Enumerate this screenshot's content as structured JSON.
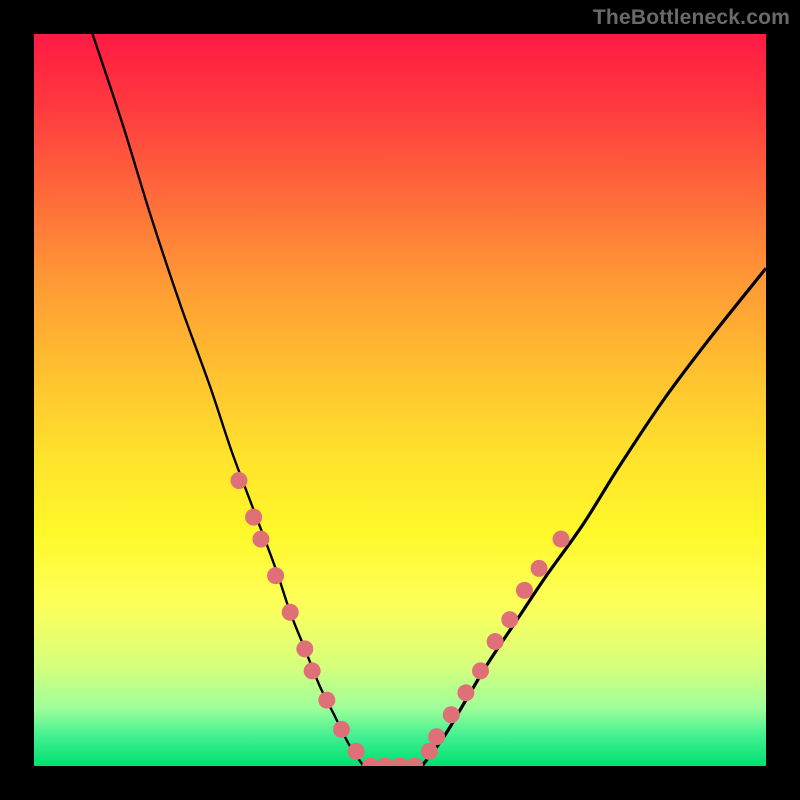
{
  "watermark": "TheBottleneck.com",
  "colors": {
    "background": "#000000",
    "gradient_top": "#ff1a44",
    "gradient_mid": "#ffe32c",
    "gradient_bottom": "#00e070",
    "curve": "#000000",
    "dot": "#e07078"
  },
  "chart_data": {
    "type": "line",
    "title": "",
    "xlabel": "",
    "ylabel": "",
    "xlim": [
      0,
      100
    ],
    "ylim": [
      0,
      100
    ],
    "series": [
      {
        "name": "left-curve",
        "x": [
          8,
          12,
          16,
          20,
          24,
          27,
          30,
          33,
          35,
          37,
          39,
          41,
          43,
          45
        ],
        "y": [
          100,
          88,
          75,
          63,
          52,
          43,
          35,
          27,
          21,
          16,
          11,
          7,
          3,
          0
        ]
      },
      {
        "name": "flat-bottom",
        "x": [
          45,
          53
        ],
        "y": [
          0,
          0
        ]
      },
      {
        "name": "right-curve",
        "x": [
          53,
          56,
          59,
          62,
          66,
          70,
          75,
          80,
          86,
          92,
          100
        ],
        "y": [
          0,
          4,
          9,
          14,
          20,
          26,
          33,
          41,
          50,
          58,
          68
        ]
      }
    ],
    "dots_left": [
      {
        "x": 28,
        "y": 39
      },
      {
        "x": 30,
        "y": 34
      },
      {
        "x": 31,
        "y": 31
      },
      {
        "x": 33,
        "y": 26
      },
      {
        "x": 35,
        "y": 21
      },
      {
        "x": 37,
        "y": 16
      },
      {
        "x": 38,
        "y": 13
      },
      {
        "x": 40,
        "y": 9
      },
      {
        "x": 42,
        "y": 5
      },
      {
        "x": 44,
        "y": 2
      }
    ],
    "dots_right": [
      {
        "x": 54,
        "y": 2
      },
      {
        "x": 55,
        "y": 4
      },
      {
        "x": 57,
        "y": 7
      },
      {
        "x": 59,
        "y": 10
      },
      {
        "x": 61,
        "y": 13
      },
      {
        "x": 63,
        "y": 17
      },
      {
        "x": 65,
        "y": 20
      },
      {
        "x": 67,
        "y": 24
      },
      {
        "x": 69,
        "y": 27
      },
      {
        "x": 72,
        "y": 31
      }
    ],
    "dots_bottom": [
      {
        "x": 46,
        "y": 0
      },
      {
        "x": 48,
        "y": 0
      },
      {
        "x": 50,
        "y": 0
      },
      {
        "x": 52,
        "y": 0
      }
    ]
  }
}
